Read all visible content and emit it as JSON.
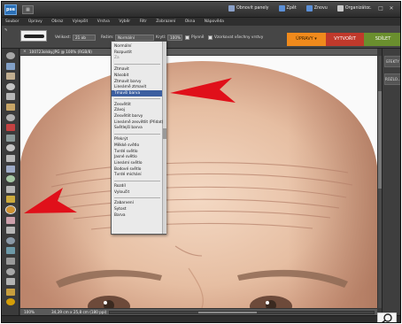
{
  "colors": {
    "accent_orange": "#f08a1c",
    "tab_red": "#c0392b",
    "tab_green": "#6a8f2e",
    "arrow_red": "#e0101a",
    "highlight": "#3c5fa0"
  },
  "app": {
    "logo": "pse",
    "mode_icon": "▦"
  },
  "top_actions": [
    {
      "label": "Obnovit panely",
      "icon": "panel-reset-icon",
      "color": "#8aa0c8"
    },
    {
      "label": "Zpět",
      "icon": "undo-icon",
      "color": "#5b8fd6"
    },
    {
      "label": "Znovu",
      "icon": "redo-icon",
      "color": "#5b8fd6"
    },
    {
      "label": "Organizátor",
      "icon": "organizer-icon",
      "color": "#c9c9c9"
    }
  ],
  "window_controls": [
    "–",
    "□",
    "✕"
  ],
  "menus": [
    "Soubor",
    "Úpravy",
    "Obraz",
    "Vylepšit",
    "Vrstva",
    "Výběr",
    "Filtr",
    "Zobrazení",
    "Okna",
    "Nápověda"
  ],
  "options": {
    "size_label": "Velikost:",
    "size_value": "21 ob",
    "mode_label": "Režim:",
    "mode_value": "Normální",
    "opacity_label": "Krytí:",
    "opacity_value": "100%",
    "airbrush_label": "Plynně",
    "sample_all_label": "Vzorkovat všechny vrstvy"
  },
  "mode_tabs": {
    "edit": "ÚPRAVY",
    "create": "VYTVOŘIT",
    "share": "SDÍLET"
  },
  "document": {
    "tab_label": "100723olsky.JPG @ 100% (RGB/8)",
    "zoom": "100%",
    "dimensions": "34,39 cm x 25,8 cm (180 ppi)"
  },
  "right_panel": [
    "EFEKTY",
    "ROZLO..."
  ],
  "blend_modes": {
    "groups": [
      [
        "Normální",
        "Rozpustit",
        "Za"
      ],
      [
        "Ztmavit",
        "Násobit",
        "Ztmavit barvy",
        "Lineárně ztmavit",
        "Tmavší barva"
      ],
      [
        "Zesvětlit",
        "Závoj",
        "Zesvětlit barvy",
        "Lineárně zesvětlit (Přidat)",
        "Světlejší barva"
      ],
      [
        "Překrýt",
        "Měkké světlo",
        "Tvrdé světlo",
        "Jasné světlo",
        "Lineární světlo",
        "Bodové světlo",
        "Tvrdé míchání"
      ],
      [
        "Rozdíl",
        "Vyloučit"
      ],
      [
        "Zabarvení",
        "Sytost",
        "Barva"
      ]
    ],
    "disabled": [
      "Za"
    ],
    "highlighted": "Tmavší barva"
  }
}
